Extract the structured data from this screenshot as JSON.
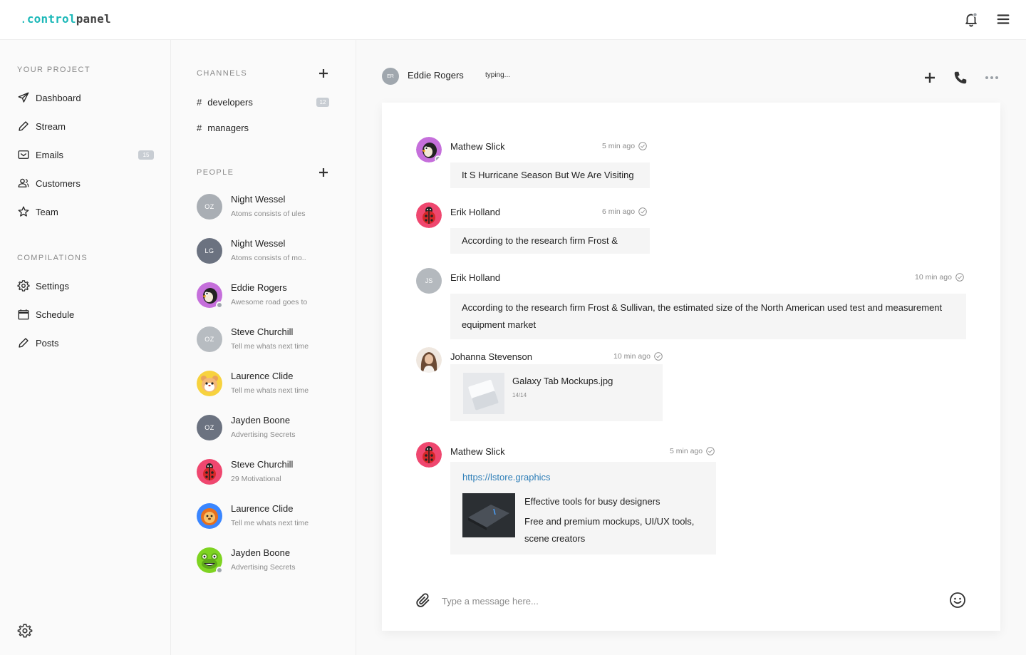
{
  "brand": {
    "dot": ".",
    "control": "control",
    "panel": "panel"
  },
  "sidebar": {
    "project_title": "YOUR PROJECT",
    "project_items": [
      {
        "label": "Dashboard",
        "icon": "paper-plane-icon"
      },
      {
        "label": "Stream",
        "icon": "pencil-icon"
      },
      {
        "label": "Emails",
        "icon": "mail-icon",
        "badge": "15"
      },
      {
        "label": "Customers",
        "icon": "users-icon"
      },
      {
        "label": "Team",
        "icon": "star-icon"
      }
    ],
    "compilations_title": "COMPILATIONS",
    "compilation_items": [
      {
        "label": "Settings",
        "icon": "gear-icon"
      },
      {
        "label": "Schedule",
        "icon": "calendar-icon"
      },
      {
        "label": "Posts",
        "icon": "pencil-icon"
      }
    ]
  },
  "channels_panel": {
    "channels_title": "CHANNELS",
    "channels": [
      {
        "hash": "#",
        "name": "developers",
        "badge": "12"
      },
      {
        "hash": "#",
        "name": "managers"
      }
    ],
    "people_title": "PEOPLE",
    "people": [
      {
        "name": "Night Wessel",
        "sub": "Atoms consists of ules",
        "initials": "OZ",
        "color": "#a9aeb4"
      },
      {
        "name": "Night Wessel",
        "sub": "Atoms consists of mo..",
        "initials": "LG",
        "color": "#6b7280"
      },
      {
        "name": "Eddie Rogers",
        "sub": "Awesome road goes to",
        "avatar": "penguin",
        "online": true
      },
      {
        "name": "Steve Churchill",
        "sub": "Tell me whats next time",
        "initials": "OZ",
        "color": "#b7bcc1"
      },
      {
        "name": "Laurence Clide",
        "sub": "Tell me whats next time",
        "avatar": "hamster"
      },
      {
        "name": "Jayden Boone",
        "sub": "Advertising Secrets",
        "initials": "OZ",
        "color": "#6b7280"
      },
      {
        "name": "Steve Churchill",
        "sub": "29 Motivational",
        "avatar": "ladybug"
      },
      {
        "name": "Laurence Clide",
        "sub": "Tell me whats next time",
        "avatar": "lion"
      },
      {
        "name": "Jayden Boone",
        "sub": "Advertising Secrets",
        "avatar": "frog",
        "online": true
      }
    ]
  },
  "chat": {
    "header": {
      "initials": "ER",
      "name": "Eddie Rogers",
      "status": "typing..."
    },
    "messages": [
      {
        "name": "Mathew Slick",
        "time": "5 min ago",
        "text": "It S Hurricane Season But We Are Visiting"
      },
      {
        "name": "Erik Holland",
        "time": "6 min ago",
        "text": "According to the research firm Frost &"
      },
      {
        "name": "Erik Holland",
        "time": "10 min ago",
        "initials": "JS",
        "text": "According to the research firm Frost & Sullivan, the estimated size of the North American used test and measurement equipment market"
      },
      {
        "name": "Johanna Stevenson",
        "time": "10 min ago",
        "file_name": "Galaxy Tab Mockups.jpg",
        "file_meta": "14/14"
      },
      {
        "name": "Mathew Slick",
        "time": "5 min ago",
        "link": "https://lstore.graphics",
        "preview_title": "Effective tools for busy designers",
        "preview_desc": "Free and premium mockups, UI/UX tools, scene creators"
      }
    ],
    "composer_placeholder": "Type a message here..."
  }
}
